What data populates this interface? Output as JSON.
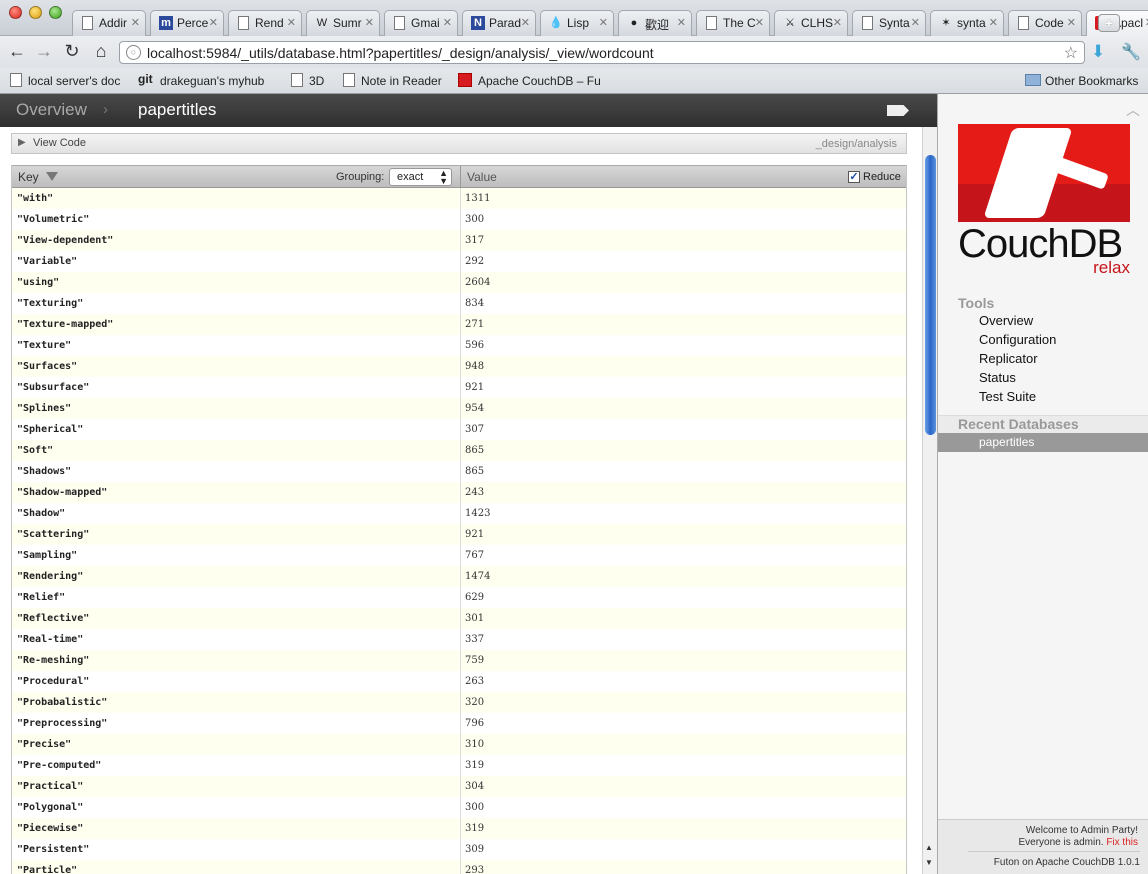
{
  "browser": {
    "tabs": [
      {
        "label": "Addir",
        "favicon": "doc-icon"
      },
      {
        "label": "Perce",
        "favicon": "mpi-icon"
      },
      {
        "label": "Rend",
        "favicon": "doc-icon"
      },
      {
        "label": "Sumr",
        "favicon": "wikipedia-icon"
      },
      {
        "label": "Gmai",
        "favicon": "doc-icon"
      },
      {
        "label": "Parad",
        "favicon": "n-icon"
      },
      {
        "label": "Lisp",
        "favicon": "drupal-icon"
      },
      {
        "label": "歡迎",
        "favicon": "flickr-icon"
      },
      {
        "label": "The C",
        "favicon": "doc-icon"
      },
      {
        "label": "CLHS",
        "favicon": "clhs-icon"
      },
      {
        "label": "Synta",
        "favicon": "doc-icon"
      },
      {
        "label": "synta",
        "favicon": "lisp-icon"
      },
      {
        "label": "Code",
        "favicon": "doc-icon"
      },
      {
        "label": "Apacl",
        "favicon": "couchdb-icon"
      }
    ],
    "new_tab": "+",
    "url": "localhost:5984/_utils/database.html?papertitles/_design/analysis/_view/wordcount",
    "bookmarks": [
      {
        "label": "local server's doc"
      },
      {
        "label": "drakeguan's myhub",
        "prefix": "git"
      },
      {
        "label": "3D"
      },
      {
        "label": "Note in Reader"
      },
      {
        "label": "Apache CouchDB – Fu"
      }
    ],
    "other_bookmarks": "Other Bookmarks"
  },
  "futon": {
    "breadcrumb": {
      "overview": "Overview",
      "database": "papertitles"
    },
    "view_code": {
      "label": "View Code",
      "design": "_design/analysis"
    },
    "table": {
      "key_header": "Key",
      "grouping_label": "Grouping:",
      "grouping_value": "exact",
      "value_header": "Value",
      "reduce_label": "Reduce",
      "reduce_checked": true,
      "rows": [
        {
          "key": "\"with\"",
          "value": "1311"
        },
        {
          "key": "\"Volumetric\"",
          "value": "300"
        },
        {
          "key": "\"View-dependent\"",
          "value": "317"
        },
        {
          "key": "\"Variable\"",
          "value": "292"
        },
        {
          "key": "\"using\"",
          "value": "2604"
        },
        {
          "key": "\"Texturing\"",
          "value": "834"
        },
        {
          "key": "\"Texture-mapped\"",
          "value": "271"
        },
        {
          "key": "\"Texture\"",
          "value": "596"
        },
        {
          "key": "\"Surfaces\"",
          "value": "948"
        },
        {
          "key": "\"Subsurface\"",
          "value": "921"
        },
        {
          "key": "\"Splines\"",
          "value": "954"
        },
        {
          "key": "\"Spherical\"",
          "value": "307"
        },
        {
          "key": "\"Soft\"",
          "value": "865"
        },
        {
          "key": "\"Shadows\"",
          "value": "865"
        },
        {
          "key": "\"Shadow-mapped\"",
          "value": "243"
        },
        {
          "key": "\"Shadow\"",
          "value": "1423"
        },
        {
          "key": "\"Scattering\"",
          "value": "921"
        },
        {
          "key": "\"Sampling\"",
          "value": "767"
        },
        {
          "key": "\"Rendering\"",
          "value": "1474"
        },
        {
          "key": "\"Relief\"",
          "value": "629"
        },
        {
          "key": "\"Reflective\"",
          "value": "301"
        },
        {
          "key": "\"Real-time\"",
          "value": "337"
        },
        {
          "key": "\"Re-meshing\"",
          "value": "759"
        },
        {
          "key": "\"Procedural\"",
          "value": "263"
        },
        {
          "key": "\"Probabalistic\"",
          "value": "320"
        },
        {
          "key": "\"Preprocessing\"",
          "value": "796"
        },
        {
          "key": "\"Precise\"",
          "value": "310"
        },
        {
          "key": "\"Pre-computed\"",
          "value": "319"
        },
        {
          "key": "\"Practical\"",
          "value": "304"
        },
        {
          "key": "\"Polygonal\"",
          "value": "300"
        },
        {
          "key": "\"Piecewise\"",
          "value": "319"
        },
        {
          "key": "\"Persistent\"",
          "value": "309"
        },
        {
          "key": "\"Particle\"",
          "value": "293"
        }
      ]
    },
    "sidebar": {
      "logo_text": "CouchDB",
      "logo_tagline": "relax",
      "tools_heading": "Tools",
      "tools": [
        "Overview",
        "Configuration",
        "Replicator",
        "Status",
        "Test Suite"
      ],
      "recent_heading": "Recent Databases",
      "recent": [
        "papertitles"
      ],
      "admin_welcome": "Welcome to Admin Party!",
      "admin_everyone": "Everyone is admin.",
      "admin_fix": "Fix this",
      "version": "Futon on Apache CouchDB 1.0.1"
    }
  }
}
